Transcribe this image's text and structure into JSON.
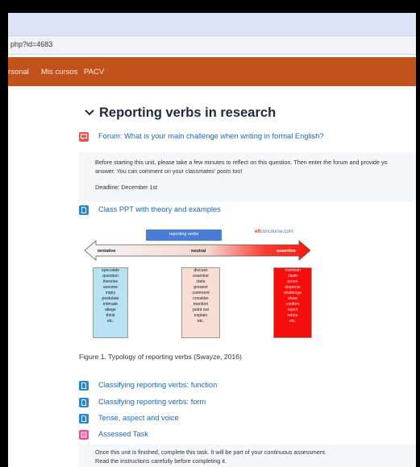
{
  "browser": {
    "url": "php?id=4683"
  },
  "nav": {
    "items": [
      "rsonal",
      "Mis cursos",
      "PACV"
    ]
  },
  "section": {
    "title": "Reporting verbs in research"
  },
  "forum": {
    "label": "Forum: What is your main challenge when writing in formal English?",
    "desc_line1": "Before starting this unit, please take a few minutes to reflect on this question. Then enter the forum and provide yo",
    "desc_line2": "answer. You can comment on your classmates' posts too!",
    "deadline": "Deadline: December 1st"
  },
  "ppt": {
    "label": "Class PPT with theory and examples"
  },
  "figure": {
    "header": "reporting verbs",
    "brand_a": "elt",
    "brand_b": "concourse.com",
    "arrow_labels": [
      "tentative",
      "neutral",
      "assertive"
    ],
    "tentative": [
      "speculate",
      "question",
      "theorise",
      "assume",
      "imply",
      "postulate",
      "intimate",
      "allege",
      "think",
      "etc."
    ],
    "neutral": [
      "discuss",
      "examine",
      "state",
      "present",
      "comment",
      "consider",
      "mention",
      "point out",
      "explain",
      "etc."
    ],
    "assertive": [
      "maintain",
      "claim",
      "prove",
      "disprove",
      "challenge",
      "show",
      "confirm",
      "reject",
      "refute",
      "etc."
    ],
    "caption": "Figure 1. Typology of reporting verbs (Swayze, 2016)"
  },
  "resources": [
    {
      "label": "Classifying reporting verbs: function"
    },
    {
      "label": "Classifying reporting verbs: form"
    },
    {
      "label": "Tense, aspect and voice"
    }
  ],
  "task": {
    "label": "Assessed Task",
    "line1": "Once this unit is finished, complete this task. It will be part of your continuous assessment.",
    "line2": "Read the instructions carefully before completing it."
  },
  "colors": {
    "nav": "#c1521c",
    "link": "#1a67b8",
    "forum_icon": "#e25a4f",
    "file_icon": "#2a86d1",
    "task_icon": "#e24f96"
  },
  "icons": {
    "forum": "forum-icon",
    "file": "file-icon",
    "task": "assignment-icon",
    "collapse": "chevron-down-icon"
  }
}
